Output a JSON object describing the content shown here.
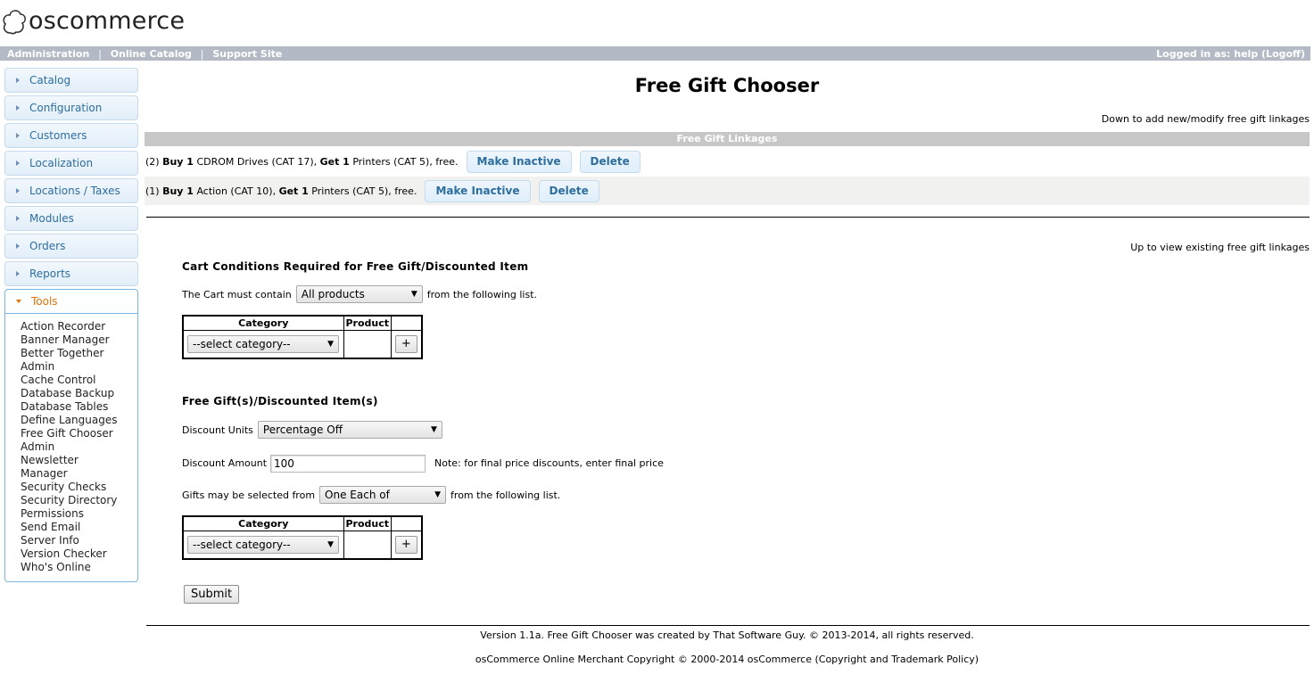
{
  "brand": {
    "logo_text": "oscommerce"
  },
  "topbar": {
    "links": [
      "Administration",
      "Online Catalog",
      "Support Site"
    ],
    "separator": "|",
    "logged_in": "Logged in as: help (Logoff)"
  },
  "sidebar": {
    "items": [
      {
        "label": "Catalog"
      },
      {
        "label": "Configuration"
      },
      {
        "label": "Customers"
      },
      {
        "label": "Localization"
      },
      {
        "label": "Locations / Taxes"
      },
      {
        "label": "Modules"
      },
      {
        "label": "Orders"
      },
      {
        "label": "Reports"
      },
      {
        "label": "Tools"
      }
    ],
    "tools_submenu": [
      "Action Recorder",
      "Banner Manager",
      "Better Together",
      "Admin",
      "Cache Control",
      "Database Backup",
      "Database Tables",
      "Define Languages",
      "Free Gift Chooser",
      "Admin",
      "Newsletter",
      "Manager",
      "Security Checks",
      "Security Directory",
      "Permissions",
      "Send Email",
      "Server Info",
      "Version Checker",
      "Who's Online"
    ]
  },
  "main": {
    "title": "Free Gift Chooser",
    "hint_down": "Down to add new/modify free gift linkages",
    "linkages_header": "Free Gift Linkages",
    "linkages": [
      {
        "id": "(2)",
        "buy_label": "Buy 1",
        "buy_item": "CDROM Drives (CAT 17),",
        "get_label": "Get 1",
        "get_item": "Printers (CAT 5), free."
      },
      {
        "id": "(1)",
        "buy_label": "Buy 1",
        "buy_item": "Action (CAT 10),",
        "get_label": "Get 1",
        "get_item": "Printers (CAT 5), free."
      }
    ],
    "make_inactive_label": "Make Inactive",
    "delete_label": "Delete",
    "hint_up": "Up to view existing free gift linkages",
    "conditions": {
      "title": "Cart Conditions Required for Free Gift/Discounted Item",
      "must_contain_prefix": "The Cart must contain",
      "must_contain_value": "All products",
      "must_contain_suffix": "from the following list."
    },
    "table_headers": {
      "category": "Category",
      "product": "Product"
    },
    "category_placeholder": "--select category--",
    "add_label": "+",
    "gifts": {
      "title": "Free Gift(s)/Discounted Item(s)",
      "discount_units_label": "Discount Units",
      "discount_units_value": "Percentage Off",
      "discount_amount_label": "Discount Amount",
      "discount_amount_value": "100",
      "discount_note": "Note: for final price discounts, enter final price",
      "selected_from_prefix": "Gifts may be selected from",
      "selected_from_value": "One Each of",
      "selected_from_suffix": "from the following list."
    },
    "submit_label": "Submit",
    "footer_version": "Version 1.1a. Free Gift Chooser was created by That Software Guy. © 2013-2014, all rights reserved.",
    "footer_copyright": "osCommerce Online Merchant Copyright © 2000-2014 osCommerce (Copyright and Trademark Policy)"
  }
}
